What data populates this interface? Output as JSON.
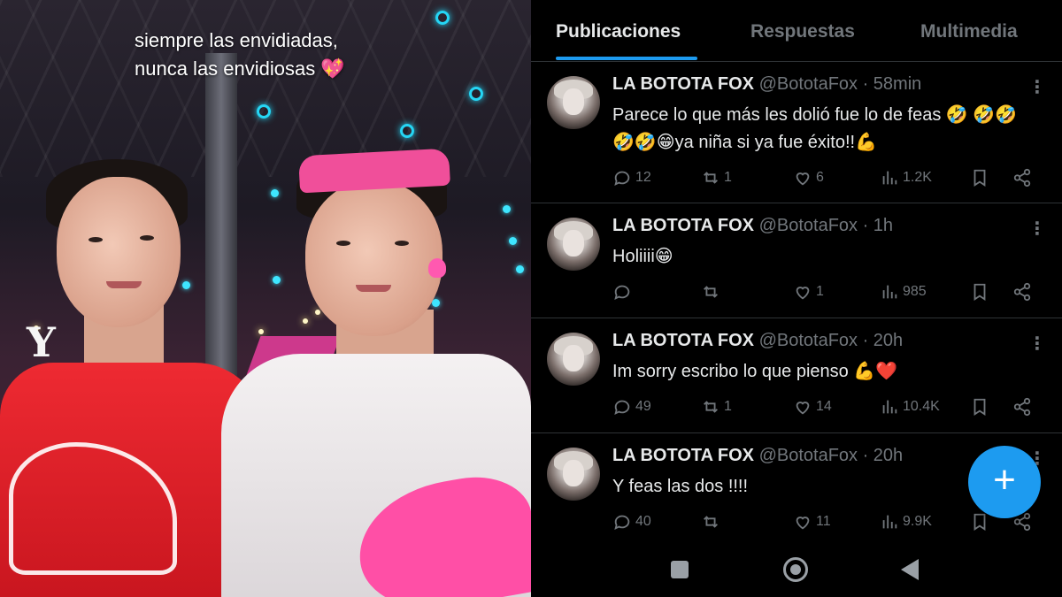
{
  "video": {
    "caption_line1": "siempre las envidiadas,",
    "caption_line2": "nunca las envidiosas 💖"
  },
  "tabs": [
    {
      "label": "Publicaciones",
      "active": true
    },
    {
      "label": "Respuestas",
      "active": false
    },
    {
      "label": "Multimedia",
      "active": false
    }
  ],
  "posts": [
    {
      "name": "LA BOTOTA FOX",
      "meta": "@BototaFox · 58min",
      "text": "Parece lo que más les dolió fue lo de feas 🤣 🤣🤣🤣🤣😁ya niña si ya fue éxito!!💪",
      "replies": "12",
      "reposts": "1",
      "likes": "6",
      "views": "1.2K"
    },
    {
      "name": "LA BOTOTA FOX",
      "meta": "@BototaFox · 1h",
      "text": "Holiiii😁",
      "replies": "",
      "reposts": "",
      "likes": "1",
      "views": "985"
    },
    {
      "name": "LA BOTOTA FOX",
      "meta": "@BototaFox · 20h",
      "text": "Im sorry escribo lo que pienso 💪❤️",
      "replies": "49",
      "reposts": "1",
      "likes": "14",
      "views": "10.4K"
    },
    {
      "name": "LA BOTOTA FOX",
      "meta": "@BototaFox · 20h",
      "text": "Y feas las dos !!!!",
      "replies": "40",
      "reposts": "",
      "likes": "11",
      "views": "9.9K"
    }
  ],
  "fab": {
    "label": "+"
  },
  "colors": {
    "accent": "#1d9bf0",
    "muted": "#71767b",
    "text": "#e7e9ea",
    "divider": "#2f3336"
  }
}
